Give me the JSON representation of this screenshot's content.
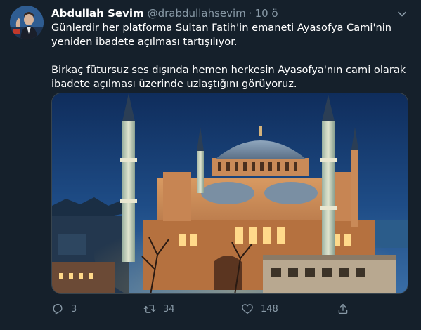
{
  "tweet": {
    "author_name": "Abdullah Sevim",
    "handle": "@drabdullahsevim",
    "separator": "·",
    "time": "10 ö",
    "paragraphs": [
      "Günlerdir her platforma Sultan Fatih'in emaneti Ayasofya Cami'nin  yeniden ibadete açılması tartışılıyor.",
      "Birkaç fütursuz ses dışında hemen herkesin Ayasofya'nın cami olarak ibadete açılması üzerinde uzlaştığını görüyoruz."
    ]
  },
  "actions": {
    "reply": {
      "icon": "reply-icon",
      "count": "3"
    },
    "retweet": {
      "icon": "retweet-icon",
      "count": "34"
    },
    "like": {
      "icon": "heart-icon",
      "count": "148"
    },
    "share": {
      "icon": "share-icon",
      "count": ""
    }
  },
  "colors": {
    "background": "#15202b",
    "secondary_text": "#8899a6",
    "primary_text": "#ffffff",
    "border": "#38444d"
  }
}
